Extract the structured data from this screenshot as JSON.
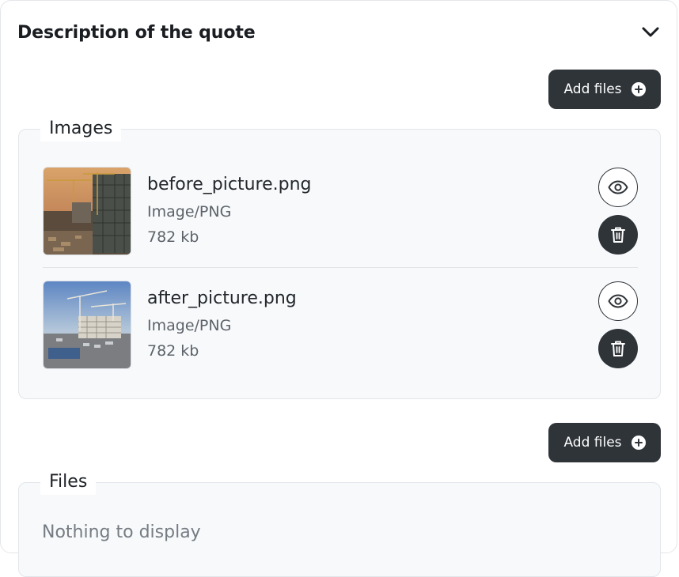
{
  "panel": {
    "title": "Description of the quote"
  },
  "images_section": {
    "add_label": "Add files",
    "legend": "Images",
    "items": [
      {
        "name": "before_picture.png",
        "type": "Image/PNG",
        "size": "782 kb"
      },
      {
        "name": "after_picture.png",
        "type": "Image/PNG",
        "size": "782 kb"
      }
    ]
  },
  "files_section": {
    "add_label": "Add files",
    "legend": "Files",
    "empty_text": "Nothing to display"
  },
  "icons": {
    "collapse": "chevron-down-icon",
    "add": "plus-circle-icon",
    "view": "eye-icon",
    "delete": "trash-icon"
  },
  "colors": {
    "button_dark": "#2f3439",
    "group_bg": "#f7f9fb",
    "border": "#e2e6ea"
  }
}
